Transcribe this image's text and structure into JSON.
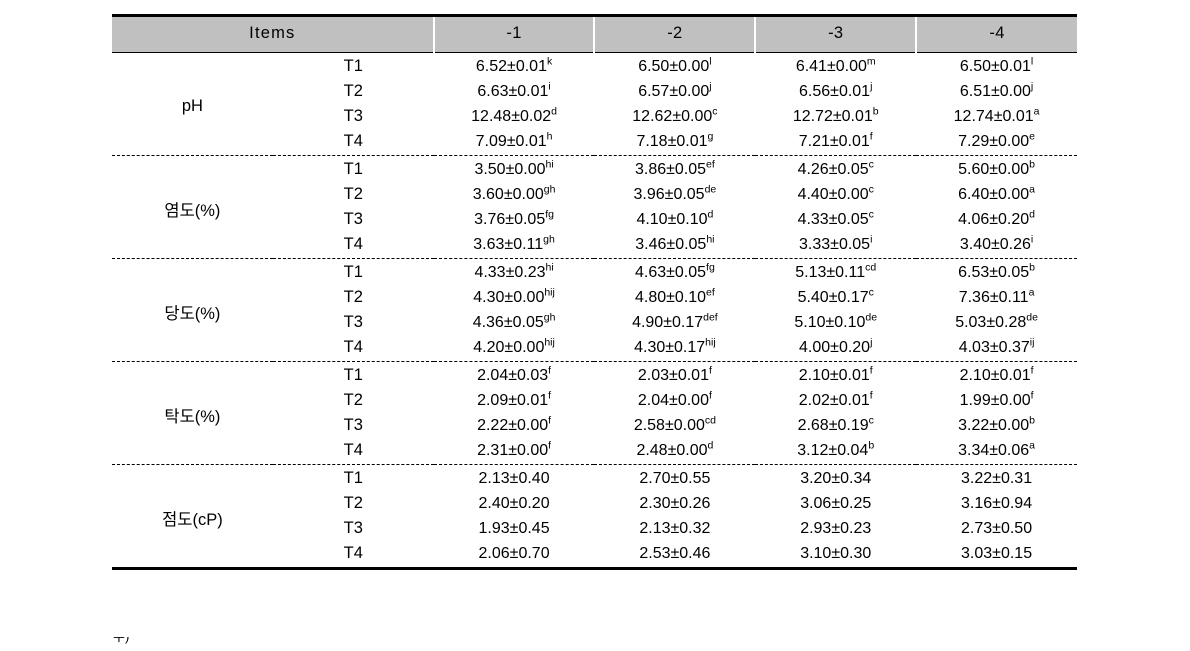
{
  "table": {
    "header": {
      "items_label": "Items",
      "columns": [
        "-1",
        "-2",
        "-3",
        "-4"
      ],
      "header_bg": "#c0c0c0"
    },
    "treatment_codes": [
      "T1",
      "T2",
      "T3",
      "T4"
    ],
    "groups": [
      {
        "label": "pH",
        "rows": [
          {
            "code": "T1",
            "cells": [
              {
                "value": "6.52±0.01",
                "sup": "k"
              },
              {
                "value": "6.50±0.00",
                "sup": "l"
              },
              {
                "value": "6.41±0.00",
                "sup": "m"
              },
              {
                "value": "6.50±0.01",
                "sup": "l"
              }
            ]
          },
          {
            "code": "T2",
            "cells": [
              {
                "value": "6.63±0.01",
                "sup": "i"
              },
              {
                "value": "6.57±0.00",
                "sup": "j"
              },
              {
                "value": "6.56±0.01",
                "sup": "j"
              },
              {
                "value": "6.51±0.00",
                "sup": "j"
              }
            ]
          },
          {
            "code": "T3",
            "cells": [
              {
                "value": "12.48±0.02",
                "sup": "d"
              },
              {
                "value": "12.62±0.00",
                "sup": "c"
              },
              {
                "value": "12.72±0.01",
                "sup": "b"
              },
              {
                "value": "12.74±0.01",
                "sup": "a"
              }
            ]
          },
          {
            "code": "T4",
            "cells": [
              {
                "value": "7.09±0.01",
                "sup": "h"
              },
              {
                "value": "7.18±0.01",
                "sup": "g"
              },
              {
                "value": "7.21±0.01",
                "sup": "f"
              },
              {
                "value": "7.29±0.00",
                "sup": "e"
              }
            ]
          }
        ]
      },
      {
        "label": "염도(%)",
        "rows": [
          {
            "code": "T1",
            "cells": [
              {
                "value": "3.50±0.00",
                "sup": "hi"
              },
              {
                "value": "3.86±0.05",
                "sup": "ef"
              },
              {
                "value": "4.26±0.05",
                "sup": "c"
              },
              {
                "value": "5.60±0.00",
                "sup": "b"
              }
            ]
          },
          {
            "code": "T2",
            "cells": [
              {
                "value": "3.60±0.00",
                "sup": "gh"
              },
              {
                "value": "3.96±0.05",
                "sup": "de"
              },
              {
                "value": "4.40±0.00",
                "sup": "c"
              },
              {
                "value": "6.40±0.00",
                "sup": "a"
              }
            ]
          },
          {
            "code": "T3",
            "cells": [
              {
                "value": "3.76±0.05",
                "sup": "fg"
              },
              {
                "value": "4.10±0.10",
                "sup": "d"
              },
              {
                "value": "4.33±0.05",
                "sup": "c"
              },
              {
                "value": "4.06±0.20",
                "sup": "d"
              }
            ]
          },
          {
            "code": "T4",
            "cells": [
              {
                "value": "3.63±0.11",
                "sup": "gh"
              },
              {
                "value": "3.46±0.05",
                "sup": "hi"
              },
              {
                "value": "3.33±0.05",
                "sup": "i"
              },
              {
                "value": "3.40±0.26",
                "sup": "i"
              }
            ]
          }
        ]
      },
      {
        "label": "당도(%)",
        "rows": [
          {
            "code": "T1",
            "cells": [
              {
                "value": "4.33±0.23",
                "sup": "hi"
              },
              {
                "value": "4.63±0.05",
                "sup": "fg"
              },
              {
                "value": "5.13±0.11",
                "sup": "cd"
              },
              {
                "value": "6.53±0.05",
                "sup": "b"
              }
            ]
          },
          {
            "code": "T2",
            "cells": [
              {
                "value": "4.30±0.00",
                "sup": "hij"
              },
              {
                "value": "4.80±0.10",
                "sup": "ef"
              },
              {
                "value": "5.40±0.17",
                "sup": "c"
              },
              {
                "value": "7.36±0.11",
                "sup": "a"
              }
            ]
          },
          {
            "code": "T3",
            "cells": [
              {
                "value": "4.36±0.05",
                "sup": "gh"
              },
              {
                "value": "4.90±0.17",
                "sup": "def"
              },
              {
                "value": "5.10±0.10",
                "sup": "de"
              },
              {
                "value": "5.03±0.28",
                "sup": "de"
              }
            ]
          },
          {
            "code": "T4",
            "cells": [
              {
                "value": "4.20±0.00",
                "sup": "hij"
              },
              {
                "value": "4.30±0.17",
                "sup": "hij"
              },
              {
                "value": "4.00±0.20",
                "sup": "j"
              },
              {
                "value": "4.03±0.37",
                "sup": "ij"
              }
            ]
          }
        ]
      },
      {
        "label": "탁도(%)",
        "rows": [
          {
            "code": "T1",
            "cells": [
              {
                "value": "2.04±0.03",
                "sup": "f"
              },
              {
                "value": "2.03±0.01",
                "sup": "f"
              },
              {
                "value": "2.10±0.01",
                "sup": "f"
              },
              {
                "value": "2.10±0.01",
                "sup": "f"
              }
            ]
          },
          {
            "code": "T2",
            "cells": [
              {
                "value": "2.09±0.01",
                "sup": "f"
              },
              {
                "value": "2.04±0.00",
                "sup": "f"
              },
              {
                "value": "2.02±0.01",
                "sup": "f"
              },
              {
                "value": "1.99±0.00",
                "sup": "f"
              }
            ]
          },
          {
            "code": "T3",
            "cells": [
              {
                "value": "2.22±0.00",
                "sup": "f"
              },
              {
                "value": "2.58±0.00",
                "sup": "cd"
              },
              {
                "value": "2.68±0.19",
                "sup": "c"
              },
              {
                "value": "3.22±0.00",
                "sup": "b"
              }
            ]
          },
          {
            "code": "T4",
            "cells": [
              {
                "value": "2.31±0.00",
                "sup": "f"
              },
              {
                "value": "2.48±0.00",
                "sup": "d"
              },
              {
                "value": "3.12±0.04",
                "sup": "b"
              },
              {
                "value": "3.34±0.06",
                "sup": "a"
              }
            ]
          }
        ]
      },
      {
        "label": "점도(cP)",
        "rows": [
          {
            "code": "T1",
            "cells": [
              {
                "value": "2.13±0.40",
                "sup": ""
              },
              {
                "value": "2.70±0.55",
                "sup": ""
              },
              {
                "value": "3.20±0.34",
                "sup": ""
              },
              {
                "value": "3.22±0.31",
                "sup": ""
              }
            ]
          },
          {
            "code": "T2",
            "cells": [
              {
                "value": "2.40±0.20",
                "sup": ""
              },
              {
                "value": "2.30±0.26",
                "sup": ""
              },
              {
                "value": "3.06±0.25",
                "sup": ""
              },
              {
                "value": "3.16±0.94",
                "sup": ""
              }
            ]
          },
          {
            "code": "T3",
            "cells": [
              {
                "value": "1.93±0.45",
                "sup": ""
              },
              {
                "value": "2.13±0.32",
                "sup": ""
              },
              {
                "value": "2.93±0.23",
                "sup": ""
              },
              {
                "value": "2.73±0.50",
                "sup": ""
              }
            ]
          },
          {
            "code": "T4",
            "cells": [
              {
                "value": "2.06±0.70",
                "sup": ""
              },
              {
                "value": "2.53±0.46",
                "sup": ""
              },
              {
                "value": "3.10±0.30",
                "sup": ""
              },
              {
                "value": "3.03±0.15",
                "sup": ""
              }
            ]
          }
        ]
      }
    ],
    "footnote_clipped": "주)"
  }
}
